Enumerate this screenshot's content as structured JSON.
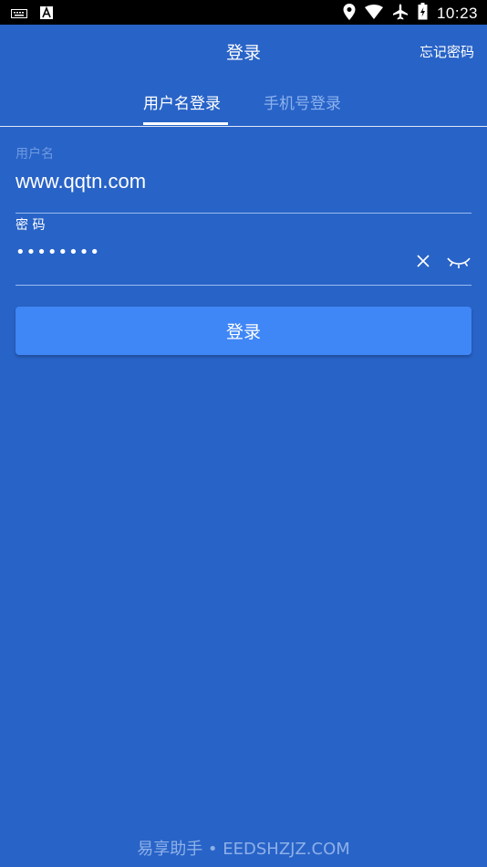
{
  "statusbar": {
    "time": "10:23",
    "icons": [
      "keyboard-icon",
      "a-badge-icon",
      "location-icon",
      "wifi-icon",
      "airplane-icon",
      "battery-icon"
    ]
  },
  "appbar": {
    "title": "登录",
    "forgot": "忘记密码"
  },
  "tabs": [
    {
      "label": "用户名登录",
      "active": true
    },
    {
      "label": "手机号登录",
      "active": false
    }
  ],
  "username": {
    "label": "用户名",
    "value": "www.qqtn.com"
  },
  "password": {
    "label": "密 码",
    "value": "••••••••"
  },
  "login_button": "登录",
  "watermark": "易享助手 • EEDSHZJZ.COM",
  "colors": {
    "background": "#2863c7",
    "button": "#3f86f6",
    "inactive_tab": "#8cb2ee"
  }
}
